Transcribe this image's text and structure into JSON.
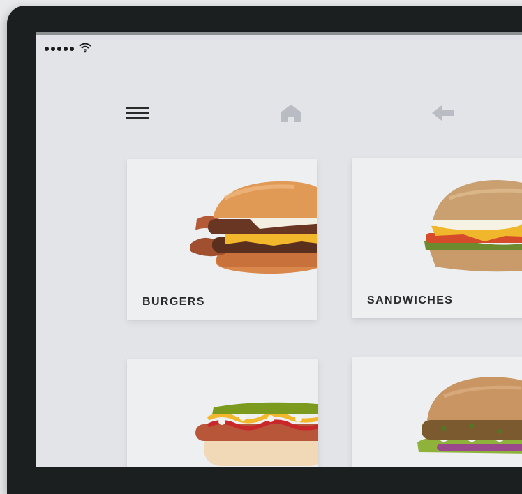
{
  "status_bar": {
    "signal_dots": 5,
    "wifi_icon": "wifi-icon"
  },
  "nav": {
    "menu_icon": "hamburger-menu-icon",
    "home_icon": "home-icon",
    "back_icon": "back-arrow-icon",
    "icon_color_active": "#2a2a2a",
    "icon_color_muted": "#b9bcc2"
  },
  "categories": [
    {
      "label": "BURGERS",
      "image": "burger-image"
    },
    {
      "label": "SANDWICHES",
      "image": "sandwich-image"
    },
    {
      "label": "",
      "image": "hotdog-image"
    },
    {
      "label": "",
      "image": "veggie-burger-image"
    }
  ],
  "colors": {
    "bezel": "#1c1f1f",
    "screen_bg": "#e3e4e8",
    "card_bg": "#eeeff1"
  }
}
